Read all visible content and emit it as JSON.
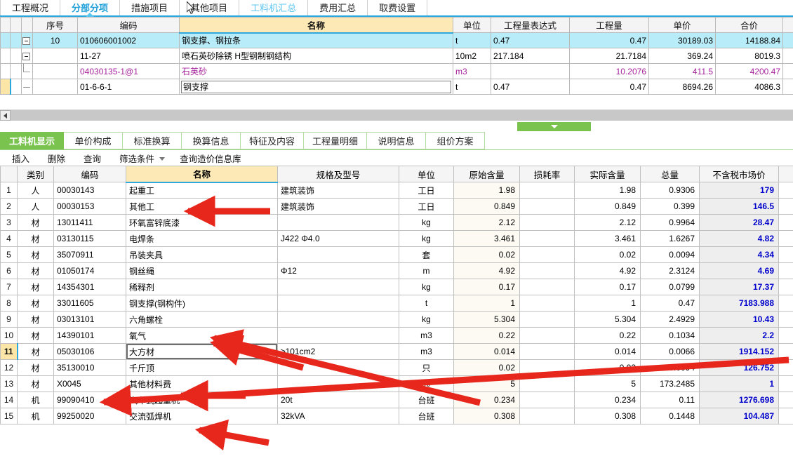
{
  "top_tabs": [
    {
      "label": "工程概况",
      "state": "normal"
    },
    {
      "label": "分部分项",
      "state": "active"
    },
    {
      "label": "措施项目",
      "state": "normal"
    },
    {
      "label": "其他项目",
      "state": "normal"
    },
    {
      "label": "工料机汇总",
      "state": "highlight"
    },
    {
      "label": "费用汇总",
      "state": "normal"
    },
    {
      "label": "取费设置",
      "state": "normal"
    }
  ],
  "upper_table": {
    "headers": [
      "序号",
      "编码",
      "名称",
      "单位",
      "工程量表达式",
      "工程量",
      "单价",
      "合价"
    ],
    "rows": [
      {
        "seq": "10",
        "code": "010606001002",
        "name": "钢支撑、钢拉条",
        "unit": "t",
        "expr": "0.47",
        "qty": "0.47",
        "price": "30189.03",
        "total": "14188.84",
        "style": "selected",
        "tree": "expand-root",
        "indent": 0
      },
      {
        "seq": "",
        "code": "11-27",
        "name": "喷石英砂除锈 H型钢制钢结构",
        "unit": "10m2",
        "expr": "217.184",
        "qty": "21.7184",
        "price": "369.24",
        "total": "8019.3",
        "style": "normal",
        "tree": "expand-child",
        "indent": 1
      },
      {
        "seq": "",
        "code": "04030135-1@1",
        "name": "石英砂",
        "unit": "m3",
        "expr": "",
        "qty": "10.2076",
        "price": "411.5",
        "total": "4200.47",
        "style": "pink",
        "tree": "elbow",
        "indent": 2
      },
      {
        "seq": "",
        "code": "01-6-6-1",
        "name": "钢支撑",
        "unit": "t",
        "expr": "0.47",
        "qty": "0.47",
        "price": "8694.26",
        "total": "4086.3",
        "style": "editing-name",
        "tree": "line",
        "indent": 1
      }
    ]
  },
  "lower_tabs": [
    {
      "label": "工料机显示",
      "state": "active"
    },
    {
      "label": "单价构成",
      "state": "normal"
    },
    {
      "label": "标准换算",
      "state": "normal"
    },
    {
      "label": "换算信息",
      "state": "normal"
    },
    {
      "label": "特征及内容",
      "state": "normal"
    },
    {
      "label": "工程量明细",
      "state": "normal"
    },
    {
      "label": "说明信息",
      "state": "normal"
    },
    {
      "label": "组价方案",
      "state": "normal"
    }
  ],
  "toolbar": {
    "insert": "插入",
    "delete": "删除",
    "query": "查询",
    "filter": "筛选条件",
    "price_db": "查询造价信息库"
  },
  "lower_table": {
    "headers": [
      "类别",
      "编码",
      "名称",
      "规格及型号",
      "单位",
      "原始含量",
      "损耗率",
      "实际含量",
      "总量",
      "不含税市场价"
    ],
    "rows": [
      {
        "idx": "1",
        "cat": "人",
        "code": "00030143",
        "name": "起重工",
        "spec": "建筑装饰",
        "unit": "工日",
        "orig": "1.98",
        "loss": "",
        "actual": "1.98",
        "total": "0.9306",
        "price": "179"
      },
      {
        "idx": "2",
        "cat": "人",
        "code": "00030153",
        "name": "其他工",
        "spec": "建筑装饰",
        "unit": "工日",
        "orig": "0.849",
        "loss": "",
        "actual": "0.849",
        "total": "0.399",
        "price": "146.5"
      },
      {
        "idx": "3",
        "cat": "材",
        "code": "13011411",
        "name": "环氧富锌底漆",
        "spec": "",
        "unit": "kg",
        "orig": "2.12",
        "loss": "",
        "actual": "2.12",
        "total": "0.9964",
        "price": "28.47"
      },
      {
        "idx": "4",
        "cat": "材",
        "code": "03130115",
        "name": "电焊条",
        "spec": "J422 Φ4.0",
        "unit": "kg",
        "orig": "3.461",
        "loss": "",
        "actual": "3.461",
        "total": "1.6267",
        "price": "4.82"
      },
      {
        "idx": "5",
        "cat": "材",
        "code": "35070911",
        "name": "吊装夹具",
        "spec": "",
        "unit": "套",
        "orig": "0.02",
        "loss": "",
        "actual": "0.02",
        "total": "0.0094",
        "price": "4.34"
      },
      {
        "idx": "6",
        "cat": "材",
        "code": "01050174",
        "name": "钢丝绳",
        "spec": "Φ12",
        "unit": "m",
        "orig": "4.92",
        "loss": "",
        "actual": "4.92",
        "total": "2.3124",
        "price": "4.69"
      },
      {
        "idx": "7",
        "cat": "材",
        "code": "14354301",
        "name": "稀释剂",
        "spec": "",
        "unit": "kg",
        "orig": "0.17",
        "loss": "",
        "actual": "0.17",
        "total": "0.0799",
        "price": "17.37"
      },
      {
        "idx": "8",
        "cat": "材",
        "code": "33011605",
        "name": "钢支撑(钢构件)",
        "spec": "",
        "unit": "t",
        "orig": "1",
        "loss": "",
        "actual": "1",
        "total": "0.47",
        "price": "7183.988"
      },
      {
        "idx": "9",
        "cat": "材",
        "code": "03013101",
        "name": "六角螺栓",
        "spec": "",
        "unit": "kg",
        "orig": "5.304",
        "loss": "",
        "actual": "5.304",
        "total": "2.4929",
        "price": "10.43"
      },
      {
        "idx": "10",
        "cat": "材",
        "code": "14390101",
        "name": "氧气",
        "spec": "",
        "unit": "m3",
        "orig": "0.22",
        "loss": "",
        "actual": "0.22",
        "total": "0.1034",
        "price": "2.2"
      },
      {
        "idx": "11",
        "cat": "材",
        "code": "05030106",
        "name": "大方材",
        "spec": "≥101cm2",
        "unit": "m3",
        "orig": "0.014",
        "loss": "",
        "actual": "0.014",
        "total": "0.0066",
        "price": "1914.152",
        "editing": true
      },
      {
        "idx": "12",
        "cat": "材",
        "code": "35130010",
        "name": "千斤顶",
        "spec": "",
        "unit": "只",
        "orig": "0.02",
        "loss": "",
        "actual": "0.02",
        "total": "0.0094",
        "price": "126.752"
      },
      {
        "idx": "13",
        "cat": "材",
        "code": "X0045",
        "name": "其他材料费",
        "spec": "",
        "unit": "%",
        "orig": "5",
        "loss": "",
        "actual": "5",
        "total": "173.2485",
        "price": "1"
      },
      {
        "idx": "14",
        "cat": "机",
        "code": "99090410",
        "name": "汽车式起重机",
        "spec": "20t",
        "unit": "台班",
        "orig": "0.234",
        "loss": "",
        "actual": "0.234",
        "total": "0.11",
        "price": "1276.698"
      },
      {
        "idx": "15",
        "cat": "机",
        "code": "99250020",
        "name": "交流弧焊机",
        "spec": "32kVA",
        "unit": "台班",
        "orig": "0.308",
        "loss": "",
        "actual": "0.308",
        "total": "0.1448",
        "price": "104.487"
      }
    ]
  },
  "editing_cell": {
    "value": "大方材",
    "ellipsis_label": "..."
  },
  "colors": {
    "accent_blue": "#29a8e0",
    "accent_green": "#7ac34e",
    "name_header_yellow": "#fde9b5",
    "selected_row": "#b8ecf8",
    "pink_text": "#a6229c",
    "price_blue": "#0000cc",
    "annotation_red": "#e8271c"
  }
}
